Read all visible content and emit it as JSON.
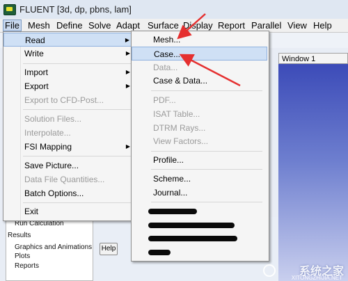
{
  "window": {
    "title": "FLUENT  [3d, dp, pbns, lam]"
  },
  "menubar": [
    "File",
    "Mesh",
    "Define",
    "Solve",
    "Adapt",
    "Surface",
    "Display",
    "Report",
    "Parallel",
    "View",
    "Help"
  ],
  "file_menu": {
    "read": "Read",
    "write": "Write",
    "import": "Import",
    "export": "Export",
    "export_cfd_post": "Export to CFD-Post...",
    "solution_files": "Solution Files...",
    "interpolate": "Interpolate...",
    "fsi_mapping": "FSI Mapping",
    "save_picture": "Save Picture...",
    "data_file_quantities": "Data File Quantities...",
    "batch_options": "Batch Options...",
    "exit": "Exit"
  },
  "read_menu": {
    "mesh": "Mesh...",
    "case": "Case...",
    "data": "Data...",
    "case_data": "Case & Data...",
    "pdf": "PDF...",
    "isat_table": "ISAT Table...",
    "dtrm_rays": "DTRM Rays...",
    "view_factors": "View Factors...",
    "profile": "Profile...",
    "scheme": "Scheme...",
    "journal": "Journal..."
  },
  "workspace": {
    "window_tab": "Window 1",
    "tree": {
      "run_calculation": "Run Calculation",
      "results": "Results",
      "graphics": "Graphics and Animations",
      "plots": "Plots",
      "reports": "Reports"
    },
    "help_button": "Help"
  },
  "watermark": {
    "text": "系统之家",
    "url": "XITONGZHIJIA.NET"
  },
  "colors": {
    "arrow": "#e53030",
    "highlight": "#cfe0f5",
    "viewport": "#3c4bb8"
  }
}
